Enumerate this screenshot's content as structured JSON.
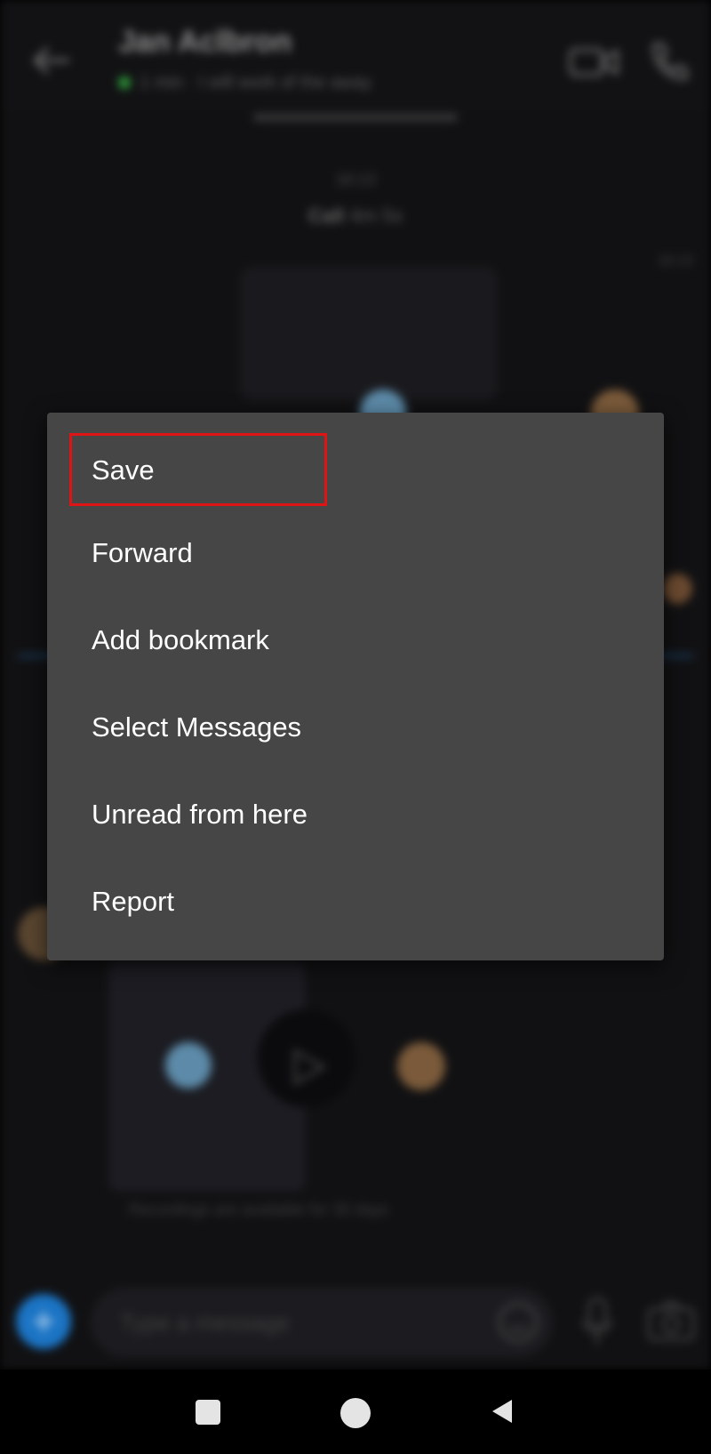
{
  "chat": {
    "contact_name": "Jan Aclbron",
    "status": "1 min · I will work of the away",
    "top_strip_text": "",
    "call_time": "16:13",
    "call_label": "Call",
    "call_duration": "4m 5s",
    "side_time": "16:13",
    "recording_note": "Recordings are available for 30 days",
    "composer_placeholder": "Type a message"
  },
  "menu": {
    "items": [
      {
        "label": "Save"
      },
      {
        "label": "Forward"
      },
      {
        "label": "Add bookmark"
      },
      {
        "label": "Select Messages"
      },
      {
        "label": "Unread from here"
      },
      {
        "label": "Report"
      }
    ],
    "highlighted_index": 0,
    "highlight_color": "#e01414",
    "background_color": "#464646"
  },
  "icons": {
    "back": "back-arrow-icon",
    "video": "video-camera-icon",
    "phone": "phone-icon",
    "plus": "plus-icon",
    "emoji": "emoji-icon",
    "mic": "microphone-icon",
    "camera": "camera-icon",
    "nav_recents": "recents-square-icon",
    "nav_home": "home-circle-icon",
    "nav_back": "back-triangle-icon"
  },
  "colors": {
    "accent_blue": "#1b74c4",
    "presence_green": "#2e9a3a"
  }
}
